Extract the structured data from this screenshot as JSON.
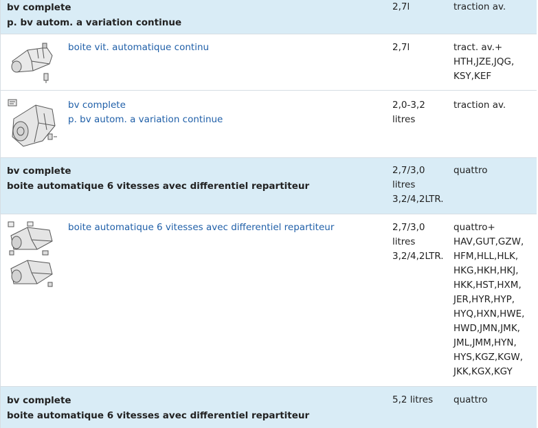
{
  "rows": [
    {
      "kind": "group",
      "title": "bv complete",
      "subtitle": "p. bv autom. a variation continue",
      "capacity": "2,7l",
      "remark": "traction av."
    },
    {
      "kind": "item",
      "icon": "transmission-icon",
      "lines": [
        "boite vit. automatique continu"
      ],
      "capacity": "2,7l",
      "remark": "tract. av.+ HTH,JZE,JQG, KSY,KEF"
    },
    {
      "kind": "item",
      "icon": "transmission-icon",
      "lines": [
        "bv complete",
        "p. bv autom. a variation continue"
      ],
      "capacity": "2,0-3,2 litres",
      "remark": "traction av."
    },
    {
      "kind": "group",
      "title": "bv complete",
      "subtitle": "boite automatique 6 vitesses avec differentiel repartiteur",
      "capacity": "2,7/3,0 litres 3,2/4,2LTR.",
      "remark": "quattro"
    },
    {
      "kind": "item",
      "icon": "transmission-icon",
      "lines": [
        "boite automatique 6 vitesses avec differentiel repartiteur"
      ],
      "capacity": "2,7/3,0 litres 3,2/4,2LTR.",
      "remark": "quattro+ HAV,GUT,GZW, HFM,HLL,HLK, HKG,HKH,HKJ, HKK,HST,HXM, JER,HYR,HYP, HYQ,HXN,HWE, HWD,JMN,JMK, JML,JMM,HYN, HYS,KGZ,KGW, JKK,KGX,KGY"
    },
    {
      "kind": "group",
      "title": "bv complete",
      "subtitle": "boite automatique 6 vitesses avec differentiel repartiteur",
      "capacity": "5,2 litres",
      "remark": "quattro"
    }
  ]
}
